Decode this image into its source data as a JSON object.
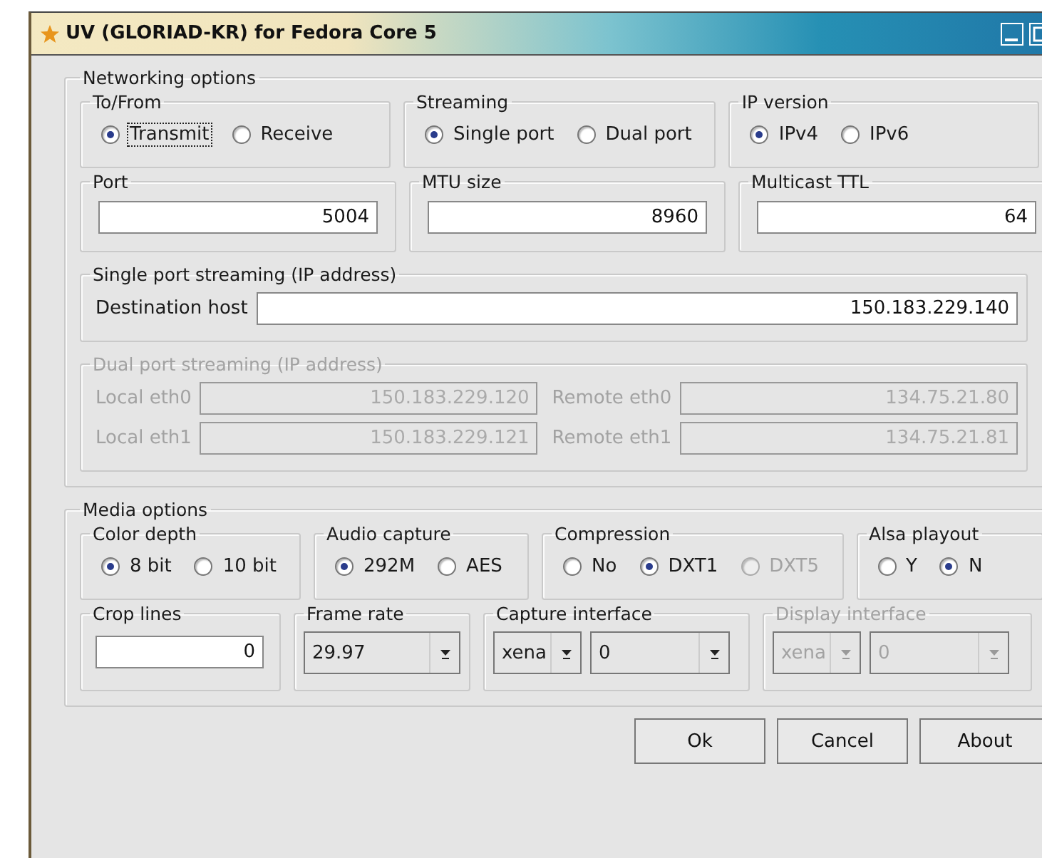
{
  "window": {
    "title": "UV (GLORIAD-KR) for Fedora Core 5"
  },
  "networking": {
    "title": "Networking options",
    "groups": [
      {
        "title": "To/From",
        "options": [
          {
            "label": "Transmit",
            "selected": true,
            "disabled": false,
            "focused": true
          },
          {
            "label": "Receive",
            "selected": false,
            "disabled": false,
            "focused": false
          }
        ]
      },
      {
        "title": "Streaming",
        "options": [
          {
            "label": "Single port",
            "selected": true,
            "disabled": false,
            "focused": false
          },
          {
            "label": "Dual port",
            "selected": false,
            "disabled": false,
            "focused": false
          }
        ]
      },
      {
        "title": "IP version",
        "options": [
          {
            "label": "IPv4",
            "selected": true,
            "disabled": false,
            "focused": false
          },
          {
            "label": "IPv6",
            "selected": false,
            "disabled": false,
            "focused": false
          }
        ]
      }
    ],
    "fields": [
      {
        "title": "Port",
        "value": "5004"
      },
      {
        "title": "MTU size",
        "value": "8960"
      },
      {
        "title": "Multicast TTL",
        "value": "64"
      }
    ],
    "single_port": {
      "title": "Single port streaming (IP address)",
      "label": "Destination host",
      "value": "150.183.229.140",
      "disabled": false
    },
    "dual_port": {
      "title": "Dual port streaming (IP address)",
      "disabled": true,
      "rows": [
        [
          {
            "label": "Local eth0",
            "value": "150.183.229.120"
          },
          {
            "label": "Remote eth0",
            "value": "134.75.21.80"
          }
        ],
        [
          {
            "label": "Local eth1",
            "value": "150.183.229.121"
          },
          {
            "label": "Remote eth1",
            "value": "134.75.21.81"
          }
        ]
      ]
    }
  },
  "media": {
    "title": "Media options",
    "groups": [
      {
        "title": "Color depth",
        "options": [
          {
            "label": "8 bit",
            "selected": true,
            "disabled": false,
            "focused": false
          },
          {
            "label": "10 bit",
            "selected": false,
            "disabled": false,
            "focused": false
          }
        ]
      },
      {
        "title": "Audio capture",
        "options": [
          {
            "label": "292M",
            "selected": true,
            "disabled": false,
            "focused": false
          },
          {
            "label": "AES",
            "selected": false,
            "disabled": false,
            "focused": false
          }
        ]
      },
      {
        "title": "Compression",
        "options": [
          {
            "label": "No",
            "selected": false,
            "disabled": false,
            "focused": false
          },
          {
            "label": "DXT1",
            "selected": true,
            "disabled": false,
            "focused": false
          },
          {
            "label": "DXT5",
            "selected": false,
            "disabled": true,
            "focused": false
          }
        ]
      },
      {
        "title": "Alsa playout",
        "options": [
          {
            "label": "Y",
            "selected": false,
            "disabled": false,
            "focused": false
          },
          {
            "label": "N",
            "selected": true,
            "disabled": false,
            "focused": false
          }
        ]
      }
    ],
    "settings": [
      {
        "title": "Crop lines",
        "kind": "field",
        "disabled": false,
        "value": "0"
      },
      {
        "title": "Frame rate",
        "kind": "combos",
        "disabled": false,
        "combos": [
          "29.97"
        ]
      },
      {
        "title": "Capture interface",
        "kind": "combos",
        "disabled": false,
        "combos": [
          "xena",
          "0"
        ]
      },
      {
        "title": "Display interface",
        "kind": "combos",
        "disabled": true,
        "combos": [
          "xena",
          "0"
        ]
      }
    ]
  },
  "buttons": [
    "Ok",
    "Cancel",
    "About"
  ]
}
